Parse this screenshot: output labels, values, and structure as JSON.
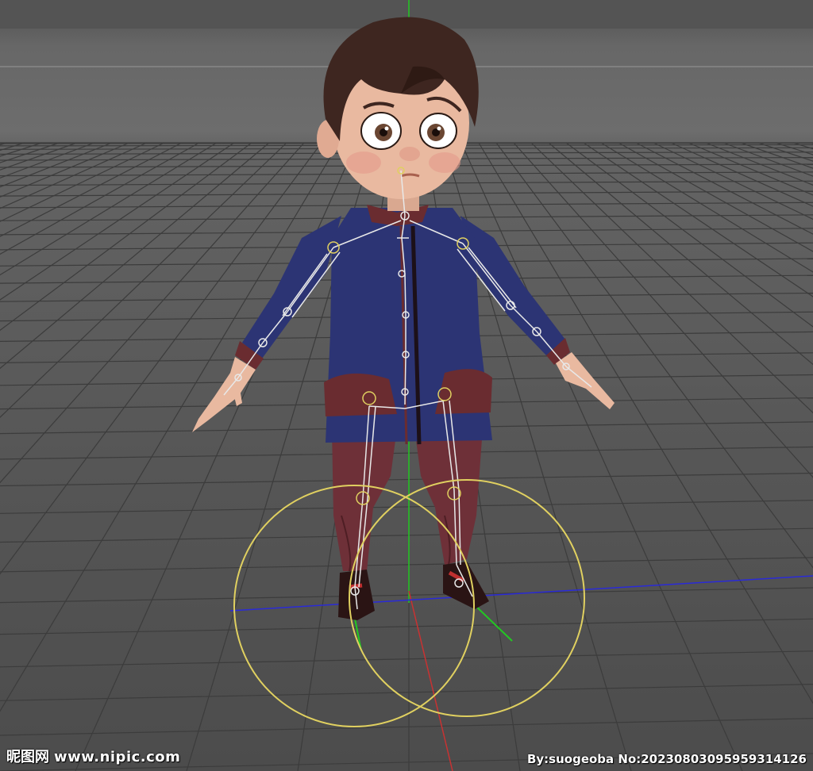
{
  "viewport": {
    "background_top": "#6d6d6d",
    "background_bottom": "#4c4c4c",
    "grid_color": "#3c3c3c",
    "axis_colors": {
      "x": "#2a2ad8",
      "y": "#22c822",
      "z": "#c83232"
    },
    "controller_color": "#e0d060",
    "bone_color": "#e8e8e8"
  },
  "character": {
    "hair_color": "#3e2620",
    "skin_color": "#e9b9a0",
    "jacket_color": "#2c3474",
    "trim_color": "#6a2c30",
    "pants_color": "#6e3038",
    "shoe_color": "#2a1414"
  },
  "watermark": {
    "brand": "昵图网",
    "site": "www.nipic.com",
    "credit": "By:suogeoba No:20230803095959314126"
  }
}
